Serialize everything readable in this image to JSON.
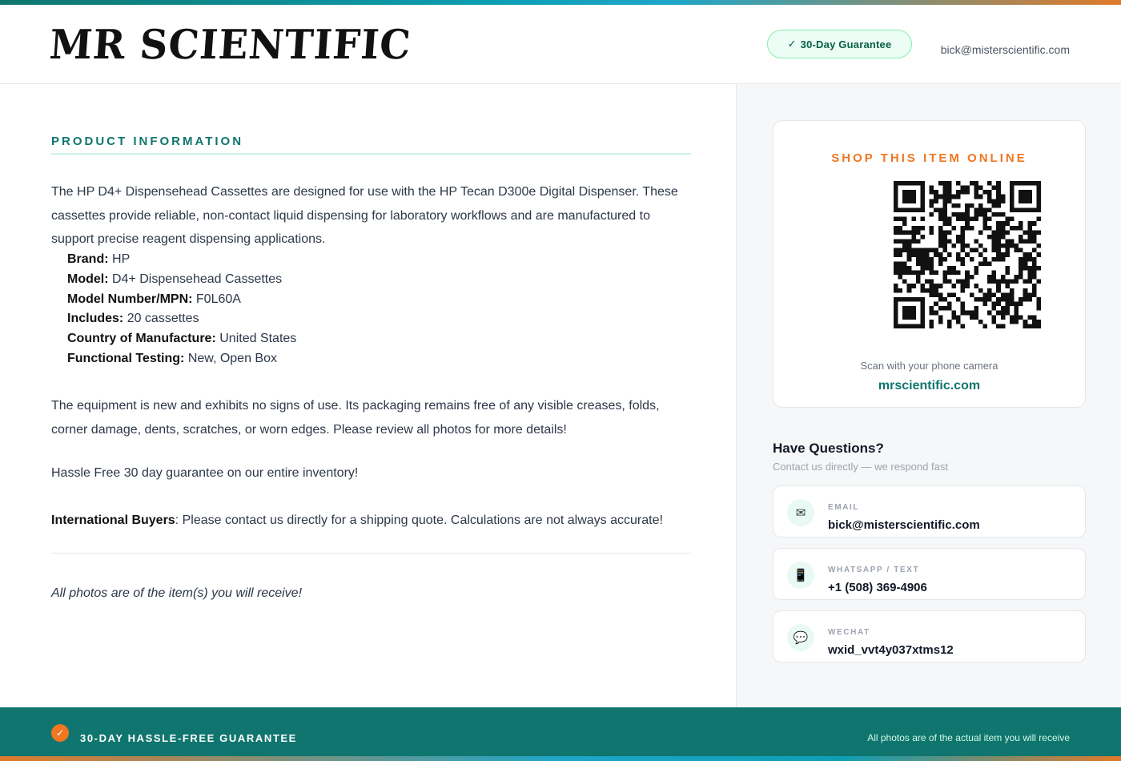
{
  "header": {
    "logo": "MR SCIENTIFIC",
    "guarantee_badge": "30-Day Guarantee",
    "email": "bick@misterscientific.com"
  },
  "product": {
    "section_title": "PRODUCT INFORMATION",
    "description": "The HP D4+ Dispensehead Cassettes are designed for use with the HP Tecan D300e Digital Dispenser. These cassettes provide reliable, non-contact liquid dispensing for laboratory workflows and are manufactured to support precise reagent dispensing applications.",
    "specs": [
      {
        "label": "Brand:",
        "value": "HP"
      },
      {
        "label": "Model:",
        "value": "D4+ Dispensehead Cassettes"
      },
      {
        "label": "Model Number/MPN:",
        "value": "F0L60A"
      },
      {
        "label": "Includes:",
        "value": "20 cassettes"
      },
      {
        "label": "Country of Manufacture:",
        "value": "United States"
      },
      {
        "label": "Functional Testing:",
        "value": "New, Open Box"
      }
    ],
    "condition": "The equipment is new and exhibits no signs of use. Its packaging remains free of any visible creases, folds, corner damage, dents, scratches, or worn edges. Please review all photos for more details!",
    "guarantee_text": "Hassle Free 30 day guarantee on our entire inventory!",
    "intl_label": "International Buyers",
    "intl_text": ": Please contact us directly for a shipping quote. Calculations are not always accurate!",
    "photos_note": "All photos are of the item(s) you will receive!"
  },
  "qr_card": {
    "title": "SHOP THIS ITEM ONLINE",
    "hint": "Scan with your phone camera",
    "site": "mrscientific.com"
  },
  "questions": {
    "title": "Have Questions?",
    "subtitle": "Contact us directly — we respond fast",
    "contacts": [
      {
        "label": "EMAIL",
        "value": "bick@misterscientific.com",
        "icon": "envelope-icon",
        "glyph": "✉"
      },
      {
        "label": "WHATSAPP / TEXT",
        "value": "+1 (508) 369-4906",
        "icon": "phone-icon",
        "glyph": "📱"
      },
      {
        "label": "WECHAT",
        "value": "wxid_vvt4y037xtms12",
        "icon": "chat-icon",
        "glyph": "💬"
      }
    ]
  },
  "footer": {
    "left": "30-DAY HASSLE-FREE GUARANTEE",
    "right": "All photos are of the actual item you will receive"
  },
  "colors": {
    "teal": "#0f766e",
    "orange": "#f07622",
    "footer_bg": "#10756f"
  }
}
